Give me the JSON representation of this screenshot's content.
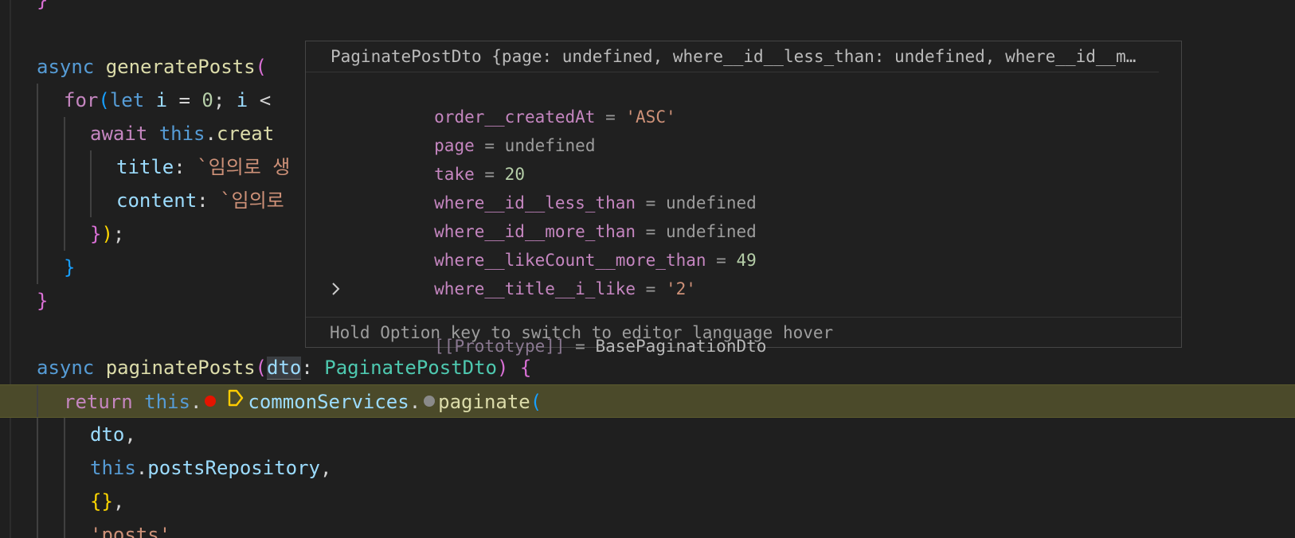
{
  "code": {
    "l0_brace": "}",
    "l2_async": "async ",
    "l2_fn": "generatePosts",
    "l2_paren": "(",
    "l3_for": "for",
    "l3_paren": "(",
    "l3_let": "let ",
    "l3_i": "i ",
    "l3_eq": "= ",
    "l3_zero": "0",
    "l3_semi": "; ",
    "l3_i2": "i ",
    "l3_lt": "<",
    "l4_await": "await ",
    "l4_this": "this",
    "l4_dot": ".",
    "l4_creat": "creat",
    "l5_title": "title",
    "l5_colon": ": ",
    "l5_str": "`임의로 생",
    "l6_content": "content",
    "l6_colon": ": ",
    "l6_str": "`임의로",
    "l7_close1": "}",
    "l7_close2": ")",
    "l7_semi": ";",
    "l8_brace": "}",
    "l9_brace": "}",
    "l11_async": "async ",
    "l11_fn": "paginatePosts",
    "l11_paren": "(",
    "l11_dto": "dto",
    "l11_colon": ": ",
    "l11_type": "PaginatePostDto",
    "l11_close": ")",
    "l11_brace": " {",
    "l12_return": "return ",
    "l12_this": "this",
    "l12_dot": ".",
    "l12_common": "commonServices",
    "l12_dot2": ".",
    "l12_paginate": "paginate",
    "l12_paren": "(",
    "l13_dto": "dto",
    "l13_comma": ",",
    "l14_this": "this",
    "l14_dot": ".",
    "l14_repo": "postsRepository",
    "l14_comma": ",",
    "l15_obj": "{}",
    "l15_comma": ",",
    "l16_str": "'posts'",
    "l16_comma": ","
  },
  "hover": {
    "header": "PaginatePostDto {page: undefined, where__id__less_than: undefined, where__id__m…",
    "rows": [
      {
        "key": "order__createdAt",
        "eq": " = ",
        "value": "'ASC'"
      },
      {
        "key": "page",
        "eq": " = ",
        "value": "undefined"
      },
      {
        "key": "take",
        "eq": " = ",
        "value": "20"
      },
      {
        "key": "where__id__less_than",
        "eq": " = ",
        "value": "undefined"
      },
      {
        "key": "where__id__more_than",
        "eq": " = ",
        "value": "undefined"
      },
      {
        "key": "where__likeCount__more_than",
        "eq": " = ",
        "value": "49"
      },
      {
        "key": "where__title__i_like",
        "eq": " = ",
        "value": "'2'"
      }
    ],
    "proto_key": "[[Prototype]]",
    "proto_eq": " = ",
    "proto_value": "BasePaginationDto",
    "footer": "Hold Option key to switch to editor language hover"
  },
  "icons": {
    "breakpoint": "breakpoint-icon",
    "stack_frame": "stack-frame-icon",
    "inline_breakpoint": "inline-breakpoint-icon",
    "expand": "chevron-right-icon"
  },
  "colors": {
    "background": "#1f1f1f",
    "debug_line": "#4b4a2a",
    "breakpoint": "#e51400",
    "stack_frame": "#ffcc00"
  }
}
